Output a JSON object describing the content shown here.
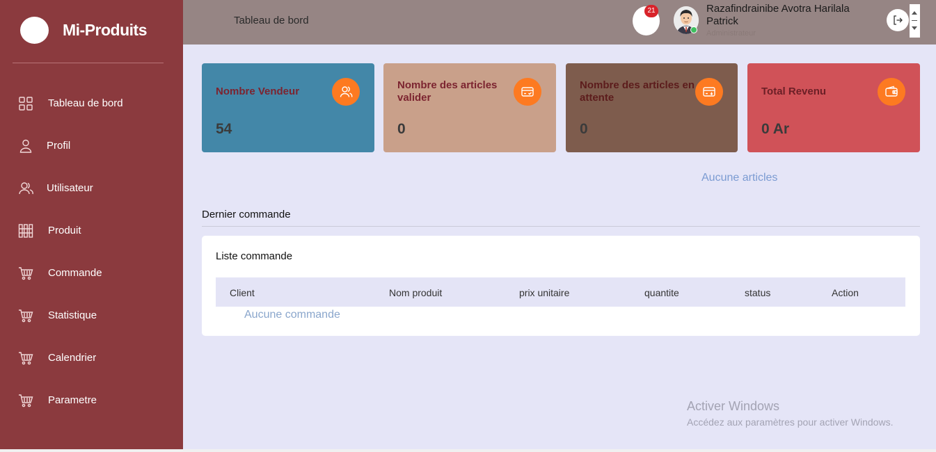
{
  "brand": {
    "name": "Mi-Produits"
  },
  "sidebar": {
    "items": [
      {
        "label": "Tableau de bord",
        "icon": "dashboard-grid-icon"
      },
      {
        "label": "Profil",
        "icon": "user-icon"
      },
      {
        "label": "Utilisateur",
        "icon": "users-icon"
      },
      {
        "label": "Produit",
        "icon": "products-grid-icon"
      },
      {
        "label": "Commande",
        "icon": "cart-icon"
      },
      {
        "label": "Statistique",
        "icon": "cart-icon"
      },
      {
        "label": "Calendrier",
        "icon": "cart-icon"
      },
      {
        "label": "Parametre",
        "icon": "cart-icon"
      }
    ]
  },
  "header": {
    "title": "Tableau de bord",
    "notification_count": "21",
    "user_name": "Razafindrainibe Avotra Harilala Patrick",
    "user_role": "Administrateur"
  },
  "cards": [
    {
      "title": "Nombre Vendeur",
      "value": "54",
      "icon": "users-icon",
      "color": "#4387a8"
    },
    {
      "title": "Nombre des articles valider",
      "value": "0",
      "icon": "card-check-icon",
      "color": "#c9a08a"
    },
    {
      "title": "Nombre des articles en attente",
      "value": "0",
      "icon": "card-pending-icon",
      "color": "#7e5c4d"
    },
    {
      "title": "Total Revenu",
      "value": "0 Ar",
      "icon": "wallet-icon",
      "color": "#d05258"
    }
  ],
  "articles_empty": "Aucune articles",
  "orders": {
    "section_title": "Dernier commande",
    "panel_title": "Liste commande",
    "columns": [
      "Client",
      "Nom produit",
      "prix unitaire",
      "quantite",
      "status",
      "Action"
    ],
    "empty_text": "Aucune commande"
  },
  "watermark": {
    "title": "Activer Windows",
    "subtitle": "Accédez aux paramètres pour activer Windows."
  },
  "colors": {
    "sidebar": "#8b3a3e",
    "topbar": "#968584",
    "background": "#e5e5f7",
    "accent_orange": "#fd7a21"
  }
}
